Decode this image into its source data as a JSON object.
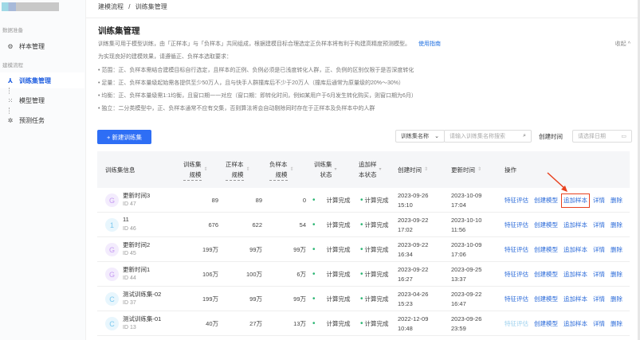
{
  "sidebar": {
    "sections": [
      "数据准备",
      "建模流程"
    ],
    "items": [
      {
        "label": "样本管理"
      },
      {
        "label": "训练集管理"
      },
      {
        "label": "模型管理"
      },
      {
        "label": "预测任务"
      }
    ]
  },
  "breadcrumb": [
    "建模流程",
    "/",
    "训练集管理"
  ],
  "title": "训练集管理",
  "description": {
    "line1": "训练集可用于模型训练，由「正样本」与「负样本」共同组成，根据建模目标合理选定正负样本将有利于构建高精度预测模型。",
    "guide_link": "使用指南",
    "line2": "为实现良好的建模效果，请遵循正、负样本选取要求：",
    "bullets": [
      "• 范围：正、负样本需结合建模目标自行选定，且样本的正例、负例必须是已浅度转化人群，正、负例的区别仅限于是否深度转化",
      "• 足量：正、负样本量级起始需各提供至少50万人，且与快手人群撞库后不少于20万人（撞库后通常为原量级的20%～30%）",
      "• 均衡：正、负样本量级需1:1均衡，且窗口期一一对应（窗口期：即转化时间，例如某用户于6月发生转化购买，则窗口期为6月）",
      "• 独立：二分类模型中，正、负样本通常不应有交集，否则算法将会自动剔除同时存在于正样本及负样本中的人群"
    ],
    "collapse": "收起 ^"
  },
  "toolbar": {
    "new_button": "+ 新建训练集",
    "filter_select": "训练集名称",
    "search_placeholder": "请输入训练集名称搜索",
    "date_label": "创建时间",
    "date_placeholder": "请选择日期"
  },
  "table": {
    "headers": {
      "info": "训练集信息",
      "size_1": "训练集",
      "size_2": "规模",
      "pos_1": "正样本",
      "pos_2": "规模",
      "neg_1": "负样本",
      "neg_2": "规模",
      "status_1": "训练集",
      "status_2": "状态",
      "add_1": "追加样",
      "add_2": "本状态",
      "created": "创建时间",
      "updated": "更新时间",
      "ops": "操作"
    },
    "rows": [
      {
        "avatar": "G",
        "name": "更新时间3",
        "id": "ID 47",
        "size": "89",
        "pos": "89",
        "neg": "0",
        "status": "计算完成",
        "add_status": "计算完成",
        "created_d": "2023-09-26",
        "created_t": "15:10",
        "updated_d": "2023-10-09",
        "updated_t": "17:04"
      },
      {
        "avatar": "1",
        "name": "11",
        "id": "ID 46",
        "size": "676",
        "pos": "622",
        "neg": "54",
        "status": "计算完成",
        "add_status": "计算完成",
        "created_d": "2023-09-22",
        "created_t": "17:02",
        "updated_d": "2023-10-10",
        "updated_t": "11:56"
      },
      {
        "avatar": "G",
        "name": "更新时间2",
        "id": "ID 45",
        "size": "199万",
        "pos": "99万",
        "neg": "99万",
        "status": "计算完成",
        "add_status": "计算完成",
        "created_d": "2023-09-22",
        "created_t": "16:34",
        "updated_d": "2023-10-09",
        "updated_t": "17:06"
      },
      {
        "avatar": "G",
        "name": "更新时间1",
        "id": "ID 44",
        "size": "106万",
        "pos": "100万",
        "neg": "6万",
        "status": "计算完成",
        "add_status": "计算完成",
        "created_d": "2023-09-22",
        "created_t": "16:27",
        "updated_d": "2023-09-25",
        "updated_t": "13:37"
      },
      {
        "avatar": "C",
        "name": "测试训练集-02",
        "id": "ID 37",
        "size": "199万",
        "pos": "99万",
        "neg": "99万",
        "status": "计算完成",
        "add_status": "计算完成",
        "created_d": "2023-04-26",
        "created_t": "15:23",
        "updated_d": "2023-09-22",
        "updated_t": "16:47"
      },
      {
        "avatar": "C",
        "name": "测试训练集-01",
        "id": "ID 13",
        "size": "40万",
        "pos": "27万",
        "neg": "13万",
        "status": "计算完成",
        "add_status": "计算完成",
        "created_d": "2022-12-09",
        "created_t": "10:48",
        "updated_d": "2023-09-26",
        "updated_t": "23:59"
      }
    ],
    "actions": [
      "特征评估",
      "创建模型",
      "追加样本",
      "详情",
      "删除"
    ]
  },
  "colors": {
    "primary": "#2e6ef5",
    "link": "#2a6ad9",
    "success": "#2bb673",
    "highlight": "#e8411e"
  }
}
